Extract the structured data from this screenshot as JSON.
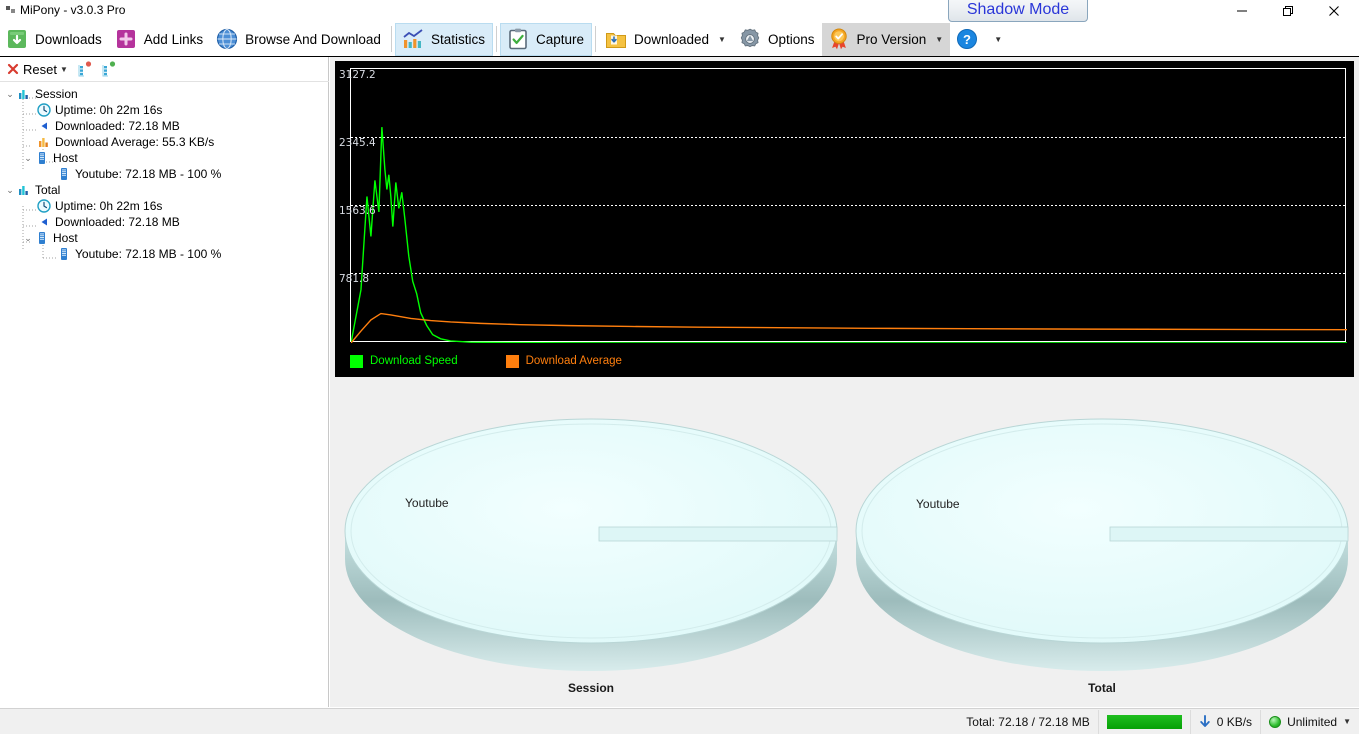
{
  "window": {
    "title": "MiPony - v3.0.3 Pro",
    "shadow_mode_label": "Shadow Mode",
    "minimize_label": "Minimize",
    "maximize_label": "Restore",
    "close_label": "Close"
  },
  "toolbar": {
    "items": [
      {
        "label": "Downloads",
        "icon": "download-box-icon",
        "state": "normal",
        "caret": false
      },
      {
        "label": "Add Links",
        "icon": "plus-icon",
        "state": "normal",
        "caret": false
      },
      {
        "label": "Browse And Download",
        "icon": "globe-icon",
        "state": "normal",
        "caret": false
      },
      {
        "label": "Statistics",
        "icon": "bar-chart-icon",
        "state": "active",
        "caret": false
      },
      {
        "label": "Capture",
        "icon": "clipboard-check-icon",
        "state": "active",
        "caret": false
      },
      {
        "label": "Downloaded",
        "icon": "folder-download-icon",
        "state": "normal",
        "caret": true
      },
      {
        "label": "Options",
        "icon": "gear-icon",
        "state": "normal",
        "caret": false
      },
      {
        "label": "Pro Version",
        "icon": "award-icon",
        "state": "pressed",
        "caret": true
      },
      {
        "label": "",
        "icon": "help-icon",
        "state": "normal",
        "caret": true
      }
    ]
  },
  "sidebar": {
    "reset_label": "Reset",
    "collapse_all_tooltip": "Collapse All",
    "expand_all_tooltip": "Expand All",
    "tree": [
      {
        "level": 0,
        "label": "Session",
        "icon": "bar-chart-icon",
        "expander": "expanded"
      },
      {
        "level": 1,
        "label": "Uptime: 0h 22m 16s",
        "icon": "clock-icon",
        "expander": "none"
      },
      {
        "level": 1,
        "label": "Downloaded: 72.18 MB",
        "icon": "arrow-left-icon",
        "expander": "none"
      },
      {
        "level": 1,
        "label": "Download Average: 55.3 KB/s",
        "icon": "bars-orange-icon",
        "expander": "none"
      },
      {
        "level": 1,
        "label": "Host",
        "icon": "server-icon",
        "expander": "expanded"
      },
      {
        "level": 2,
        "label": "Youtube: 72.18 MB - 100 %",
        "icon": "server-icon",
        "expander": "none"
      },
      {
        "level": 0,
        "label": "Total",
        "icon": "bar-chart-icon",
        "expander": "expanded"
      },
      {
        "level": 1,
        "label": "Uptime: 0h 22m 16s",
        "icon": "clock-icon",
        "expander": "none"
      },
      {
        "level": 1,
        "label": "Downloaded: 72.18 MB",
        "icon": "arrow-left-icon",
        "expander": "none"
      },
      {
        "level": 1,
        "label": "Host",
        "icon": "server-icon",
        "expander": "expanded"
      },
      {
        "level": 2,
        "label": "Youtube: 72.18 MB - 100 %",
        "icon": "server-icon",
        "expander": "none"
      }
    ]
  },
  "statusbar": {
    "total_label": "Total: 72.18 / 72.18 MB",
    "progress_percent": 100,
    "speed_label": "0 KB/s",
    "speed_icon": "download-arrow-icon",
    "limit_label": "Unlimited",
    "limit_icon": "green-circle-icon"
  },
  "colors": {
    "download_speed": "#00ff00",
    "download_average": "#ff7f0e",
    "chart_background": "#000000",
    "pie_slice": "#e2fbfb",
    "progress_green": "#12ad12",
    "accent_blue": "#2a36d8"
  },
  "chart_data": [
    {
      "type": "line",
      "name": "speed-history-chart",
      "title": "",
      "xlabel": "",
      "ylabel": "",
      "background": "#000000",
      "grid": true,
      "legend_position": "bottom-left",
      "ylim": [
        0,
        3909.0
      ],
      "yticks": [
        781.8,
        1563.6,
        2345.4,
        3127.2
      ],
      "ytick_labels": [
        "781.8",
        "1563.6",
        "2345.4",
        "3127.2"
      ],
      "series": [
        {
          "name": "Download Speed",
          "color": "#00ff00",
          "x": [
            0.0,
            1.0,
            1.6,
            2.0,
            2.4,
            2.8,
            3.1,
            3.4,
            3.6,
            3.8,
            4.0,
            4.2,
            4.5,
            4.8,
            5.1,
            5.4,
            5.8,
            6.2,
            6.6,
            7.0,
            7.6,
            8.2,
            9.0,
            10.0,
            12.0,
            16.0,
            22.0,
            30.0,
            45.0,
            60.0,
            80.0,
            100.0
          ],
          "y": [
            0,
            760,
            2090,
            1520,
            2320,
            1870,
            3080,
            2480,
            2190,
            2400,
            2090,
            1660,
            2290,
            1920,
            2150,
            1780,
            1240,
            880,
            700,
            430,
            250,
            120,
            60,
            30,
            12,
            6,
            3,
            1,
            0,
            0,
            0,
            0
          ]
        },
        {
          "name": "Download Average",
          "color": "#ff7f0e",
          "x": [
            0.0,
            1.0,
            2.0,
            3.0,
            4.0,
            5.0,
            6.0,
            8.0,
            10.0,
            13.0,
            17.0,
            22.0,
            28.0,
            35.0,
            43.0,
            52.0,
            62.0,
            74.0,
            88.0,
            100.0
          ],
          "y": [
            0,
            170,
            330,
            420,
            400,
            375,
            350,
            320,
            300,
            280,
            262,
            248,
            236,
            226,
            218,
            210,
            204,
            198,
            193,
            190
          ]
        }
      ]
    },
    {
      "type": "pie",
      "name": "session-host-pie",
      "title": "Session",
      "three_d": true,
      "labels": [
        "Youtube"
      ],
      "values": [
        100
      ],
      "value_text": [
        "72.18 MB - 100 %"
      ],
      "colors": [
        "#e2fbfb"
      ]
    },
    {
      "type": "pie",
      "name": "total-host-pie",
      "title": "Total",
      "three_d": true,
      "labels": [
        "Youtube"
      ],
      "values": [
        100
      ],
      "value_text": [
        "72.18 MB - 100 %"
      ],
      "colors": [
        "#e2fbfb"
      ]
    }
  ]
}
